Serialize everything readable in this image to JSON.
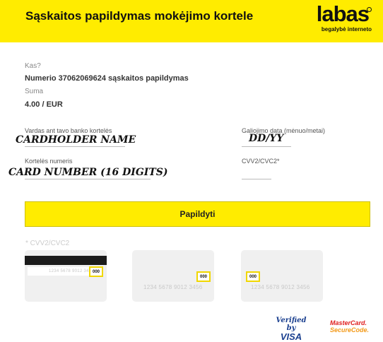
{
  "header": {
    "title": "Sąskaitos papildymas mokėjimo kortele",
    "logo_text": "labas",
    "logo_tagline_bold": "begalybė",
    "logo_tagline_rest": " interneto",
    "background": "#ffec00"
  },
  "info": {
    "what_label": "Kas?",
    "what_value": "Numerio 37062069624 sąskaitos papildymas",
    "amount_label": "Suma",
    "amount_value": "4.00 / EUR"
  },
  "form": {
    "name_label": "Vardas ant tavo banko kortelės",
    "name_value": "CARDHOLDER NAME",
    "expiry_label": "Galiojimo data (mėnuo/metai)",
    "expiry_value": "DD/YY",
    "number_label": "Kortelės numeris",
    "number_value": "CARD NUMBER (16 DIGITS)",
    "cvv_label": "CVV2/CVC2*"
  },
  "submit_label": "Papildyti",
  "cvv_help": {
    "label": "* CVV2/CVC2",
    "card_number_sample": "1234 5678 9012 3456",
    "cvv_sample": "000"
  },
  "badges": {
    "visa_line1": "Verified by",
    "visa_line2": "VISA",
    "mc_line1": "MasterCard.",
    "mc_line2": "SecureCode."
  }
}
